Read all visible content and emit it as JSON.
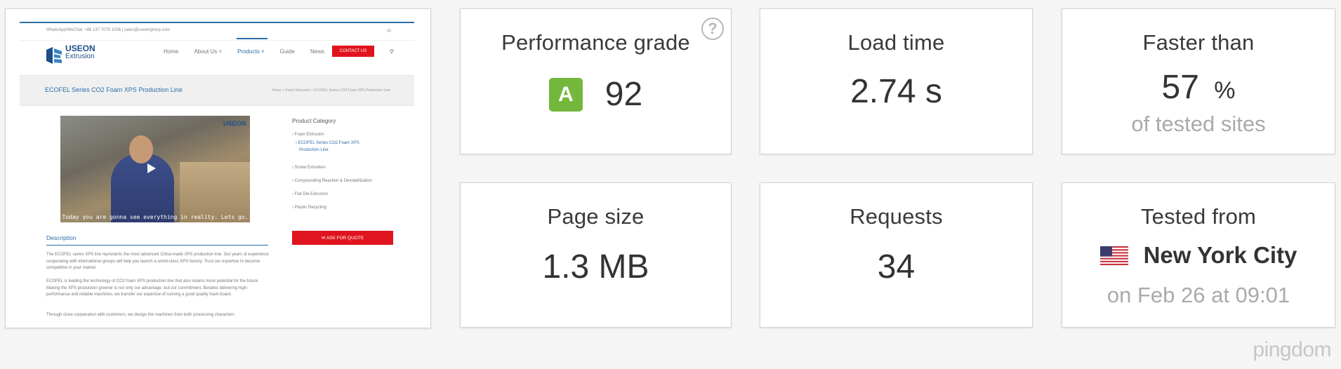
{
  "screenshot": {
    "contact": "WhatsApp/WeChat: +86 137 7075 1006  |  sales@useongroup.com",
    "logo_line1": "USEON",
    "logo_line2": "Extrusion",
    "nav": [
      "Home",
      "About Us ˅",
      "Products ˅",
      "Guide",
      "News"
    ],
    "contact_button": "CONTACT US",
    "page_title": "ECOFEL Series CO2 Foam XPS Production Line",
    "breadcrumb": "Home  >  Foam Extrusion  >  ECOFEL Series CO2 Foam XPS Production Line",
    "video_logo": "USEON",
    "video_caption": "Today you are gonna see everything in reality. Lets go.",
    "sidebar_heading": "Product Category",
    "categories": [
      "›  Foam Extrusion",
      "›  ECOFEL Series CO2 Foam XPS",
      "Production Line",
      "›  Screw Extruders",
      "›  Compounding Reaction & Devolatilization",
      "›  Flat Die Extrusion",
      "›  Plastic Recycling"
    ],
    "quote_button": "✉  ASK FOR QUOTE",
    "description_tab": "Description",
    "paragraphs": [
      "The ECOFEL series XPS line represents the most advanced China-made XPS production line. Our years of experience cooperating with international groups will help you launch a world-class XPS factory. Trust our expertise to become competitive in your market.",
      "ECOFEL is leading the technology of CO2 foam XPS production line that also retains more potential for the future. Making the XPS production greener is not only our advantage, but our commitment. Besides delivering high-performance and reliable machines, we transfer our expertise of running a good quality foam board.",
      "Through close cooperation with customers, we design the machines from both processing characters"
    ]
  },
  "metrics": {
    "performance": {
      "title": "Performance grade",
      "grade": "A",
      "score": "92",
      "help_icon": "question-circle-icon",
      "grade_color": "#73b83d"
    },
    "load_time": {
      "title": "Load time",
      "value": "2.74 s"
    },
    "faster_than": {
      "title": "Faster than",
      "value": "57",
      "unit": "%",
      "sub": "of tested sites"
    },
    "page_size": {
      "title": "Page size",
      "value": "1.3 MB"
    },
    "requests": {
      "title": "Requests",
      "value": "34"
    },
    "tested_from": {
      "title": "Tested from",
      "flag": "us-flag-icon",
      "city": "New York City",
      "sub": "on Feb 26 at 09:01"
    }
  },
  "brand": "pingdom"
}
